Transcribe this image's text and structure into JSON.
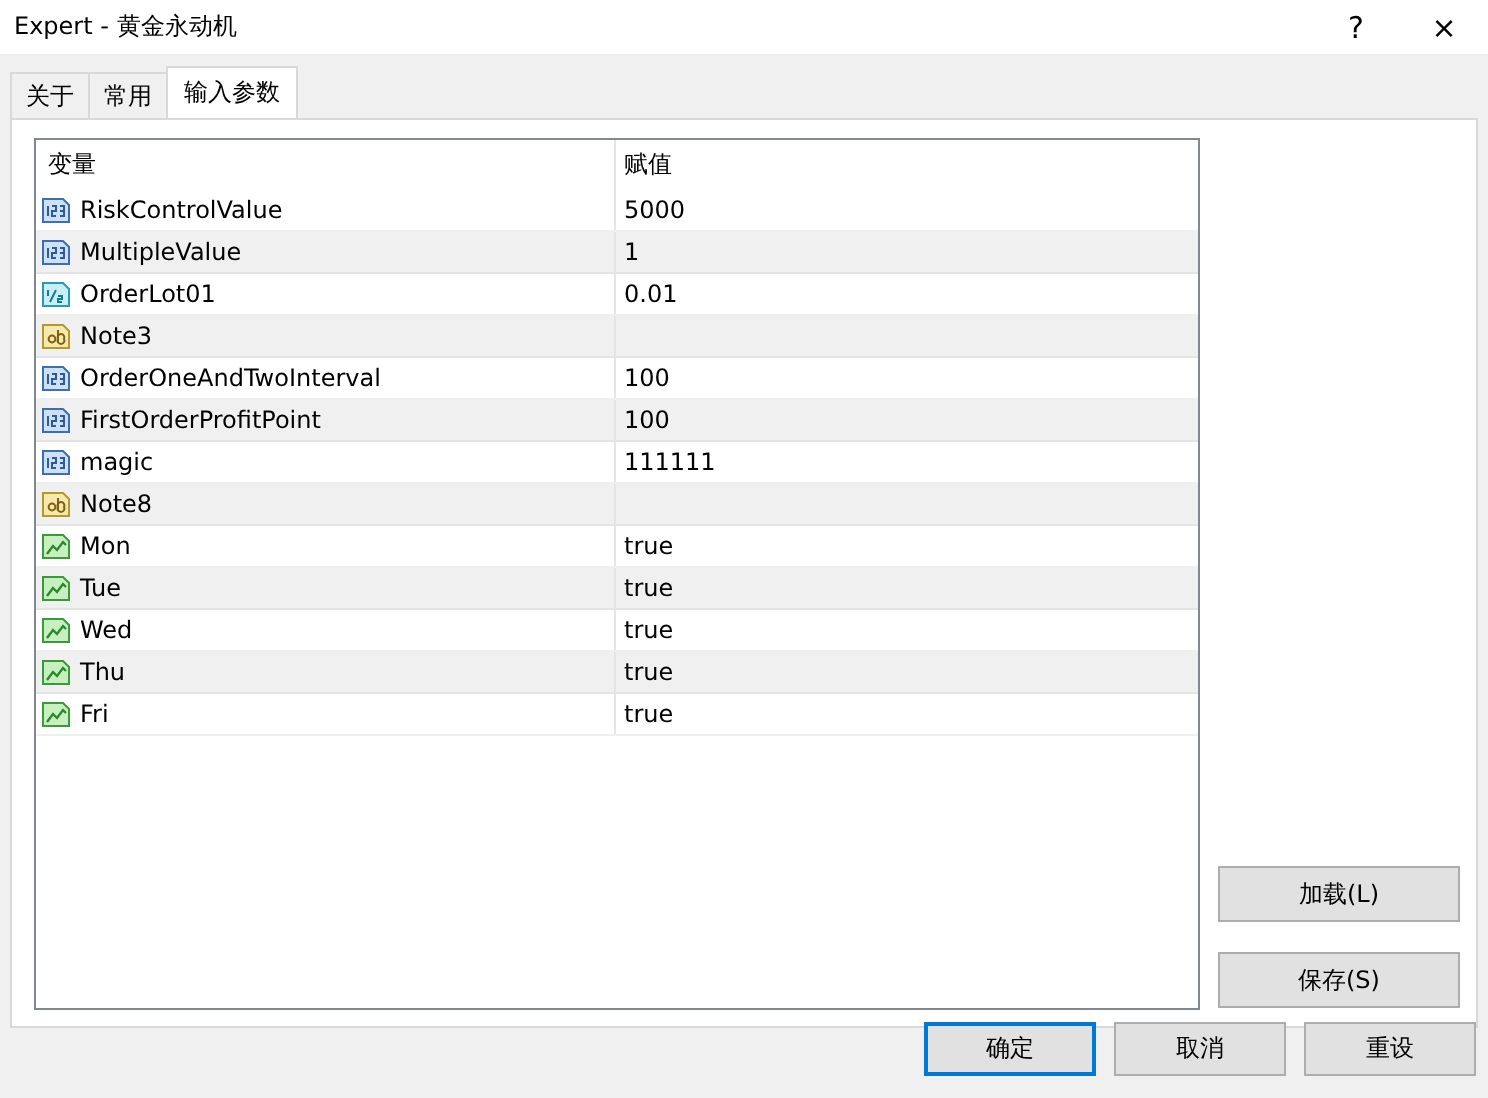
{
  "window": {
    "title": "Expert - 黄金永动机",
    "help": "?",
    "close": "×"
  },
  "tabs": [
    {
      "label": "关于",
      "selected": false
    },
    {
      "label": "常用",
      "selected": false
    },
    {
      "label": "输入参数",
      "selected": true
    }
  ],
  "table": {
    "columns": [
      "变量",
      "赋值"
    ],
    "rows": [
      {
        "kind": "int",
        "name": "RiskControlValue",
        "value": "5000"
      },
      {
        "kind": "int",
        "name": "MultipleValue",
        "value": "1"
      },
      {
        "kind": "double",
        "name": "OrderLot01",
        "value": "0.01"
      },
      {
        "kind": "string",
        "name": "Note3",
        "value": ""
      },
      {
        "kind": "int",
        "name": "OrderOneAndTwoInterval",
        "value": "100"
      },
      {
        "kind": "int",
        "name": "FirstOrderProfitPoint",
        "value": "100"
      },
      {
        "kind": "int",
        "name": "magic",
        "value": "111111"
      },
      {
        "kind": "string",
        "name": "Note8",
        "value": ""
      },
      {
        "kind": "bool",
        "name": "Mon",
        "value": "true"
      },
      {
        "kind": "bool",
        "name": "Tue",
        "value": "true"
      },
      {
        "kind": "bool",
        "name": "Wed",
        "value": "true"
      },
      {
        "kind": "bool",
        "name": "Thu",
        "value": "true"
      },
      {
        "kind": "bool",
        "name": "Fri",
        "value": "true"
      }
    ]
  },
  "side_buttons": [
    "加载(L)",
    "保存(S)"
  ],
  "buttons": [
    {
      "label": "确定",
      "default": true
    },
    {
      "label": "取消",
      "default": false
    },
    {
      "label": "重设",
      "default": false
    }
  ]
}
